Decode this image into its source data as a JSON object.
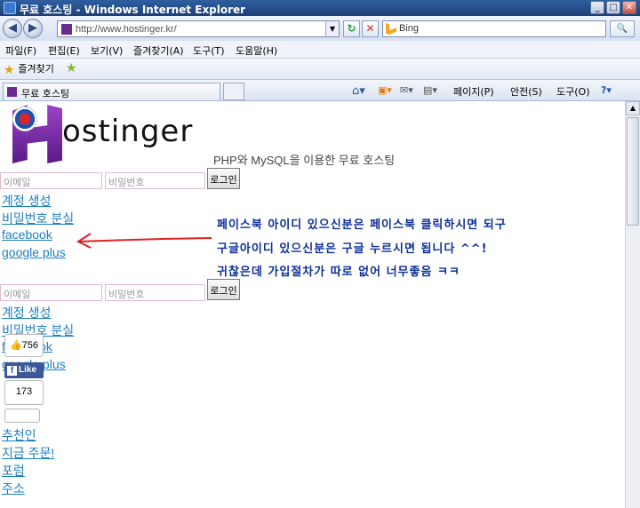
{
  "window": {
    "title": "무료 호스팅 - Windows Internet Explorer",
    "min": "_",
    "max": "□",
    "close": "✕"
  },
  "address": {
    "url": "http://www.hostinger.kr/",
    "dropdown": "▼",
    "refresh": "↻",
    "stop": "✕"
  },
  "search": {
    "engine": "Bing",
    "go": "🔍"
  },
  "menu": {
    "file": "파일(F)",
    "edit": "편집(E)",
    "view": "보기(V)",
    "favorites": "즐겨찾기(A)",
    "tools": "도구(T)",
    "help": "도움말(H)"
  },
  "favorites_bar": {
    "label": "즐겨찾기"
  },
  "tab": {
    "label": "무료 호스팅"
  },
  "commands": {
    "page": "페이지(P)",
    "safety": "안전(S)",
    "tools": "도구(O)"
  },
  "logo": {
    "h_letter": "H",
    "rest": "ostinger"
  },
  "page": {
    "tagline": "PHP와 MySQL을 이용한 무료 호스팅",
    "login1": {
      "email_placeholder": "이메일",
      "password_placeholder": "비밀번호",
      "button": "로그인"
    },
    "links1": [
      "계정 생성",
      "비밀번호 분실",
      "facebook",
      "google plus"
    ],
    "note": [
      "페이스북 아이디 있으신분은 페이스북 클릭하시면 되구",
      "구글아이디 있으신분은 구글 누르시면 됩니다 ^^!",
      "귀찮은데 가입절차가 따로 없어 너무좋음 ㅋㅋ"
    ],
    "login2": {
      "email_placeholder": "이메일",
      "password_placeholder": "비밀번호",
      "button": "로그인"
    },
    "links2": [
      "계정 생성",
      "비밀번호 분실",
      "facebook",
      "google plus",
      "",
      "추천인",
      "지금 주문!",
      "포럼",
      "주소"
    ]
  },
  "social": {
    "likes": "756",
    "like_button": "Like",
    "count": "173",
    "fb_letter": "f"
  },
  "colors": {
    "link": "#1c7fc2",
    "note": "#0c2f9a",
    "arrow": "#e02020",
    "brand": "#6c2a8f"
  }
}
